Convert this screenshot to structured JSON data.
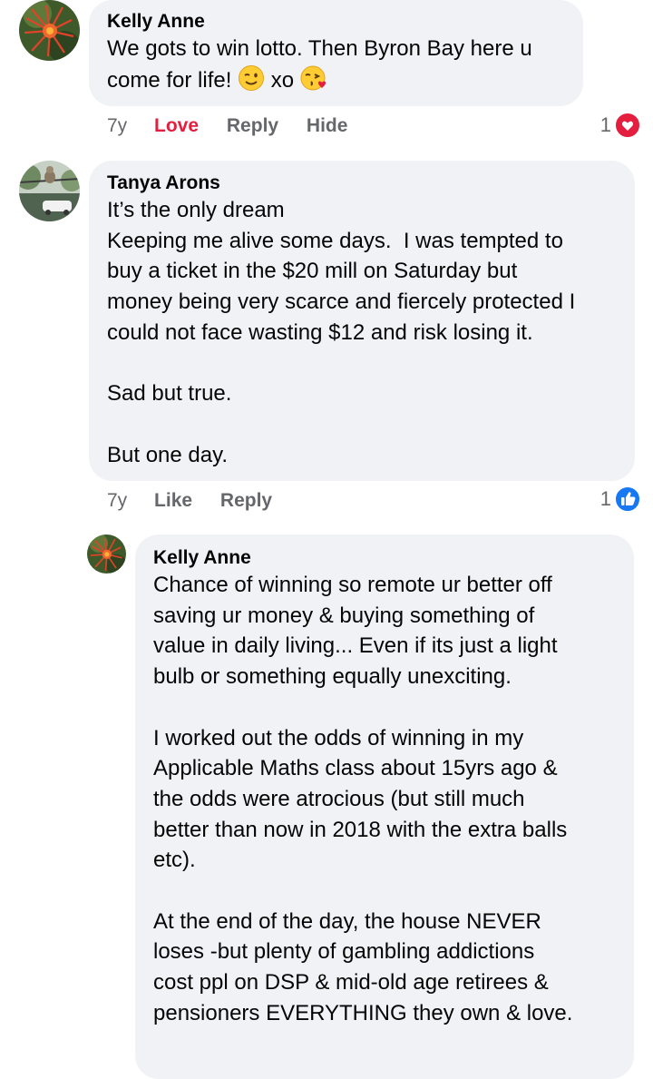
{
  "comments": [
    {
      "author": "Kelly Anne",
      "text_prefix": "We gots to win lotto. Then Byron Bay here u\ncome for life! ",
      "text_mid": " xo ",
      "emoji_1": "winking-face",
      "emoji_2": "face-blowing-kiss",
      "age": "7y",
      "action_1": "Love",
      "action_2": "Reply",
      "action_3": "Hide",
      "reaction_count": "1",
      "reaction_type": "heart",
      "reaction_color": "#e41e3f"
    },
    {
      "author": "Tanya Arons",
      "text": "It’s the only dream\nKeeping me alive some days.  I was tempted to\nbuy a ticket in the $20 mill on Saturday but\nmoney being very scarce and fiercely protected I\ncould not face wasting $12 and risk losing it.\n\nSad but true.\n\nBut one day.",
      "age": "7y",
      "action_1": "Like",
      "action_2": "Reply",
      "reaction_count": "1",
      "reaction_type": "thumbs-up",
      "reaction_color": "#1877f2"
    },
    {
      "author": "Kelly Anne",
      "text": "Chance of winning so remote ur better off\nsaving ur money & buying something of\nvalue in daily living... Even if its just a light\nbulb or something equally unexciting.\n\nI worked out the odds of winning in my\nApplicable Maths class about 15yrs ago &\nthe odds were atrocious (but still much\nbetter than now in 2018 with the extra balls\netc).\n\nAt the end of the day, the house NEVER\nloses -but plenty of gambling addictions\ncost ppl on DSP & mid-old age retirees &\npensioners EVERYTHING they own & love."
    }
  ]
}
